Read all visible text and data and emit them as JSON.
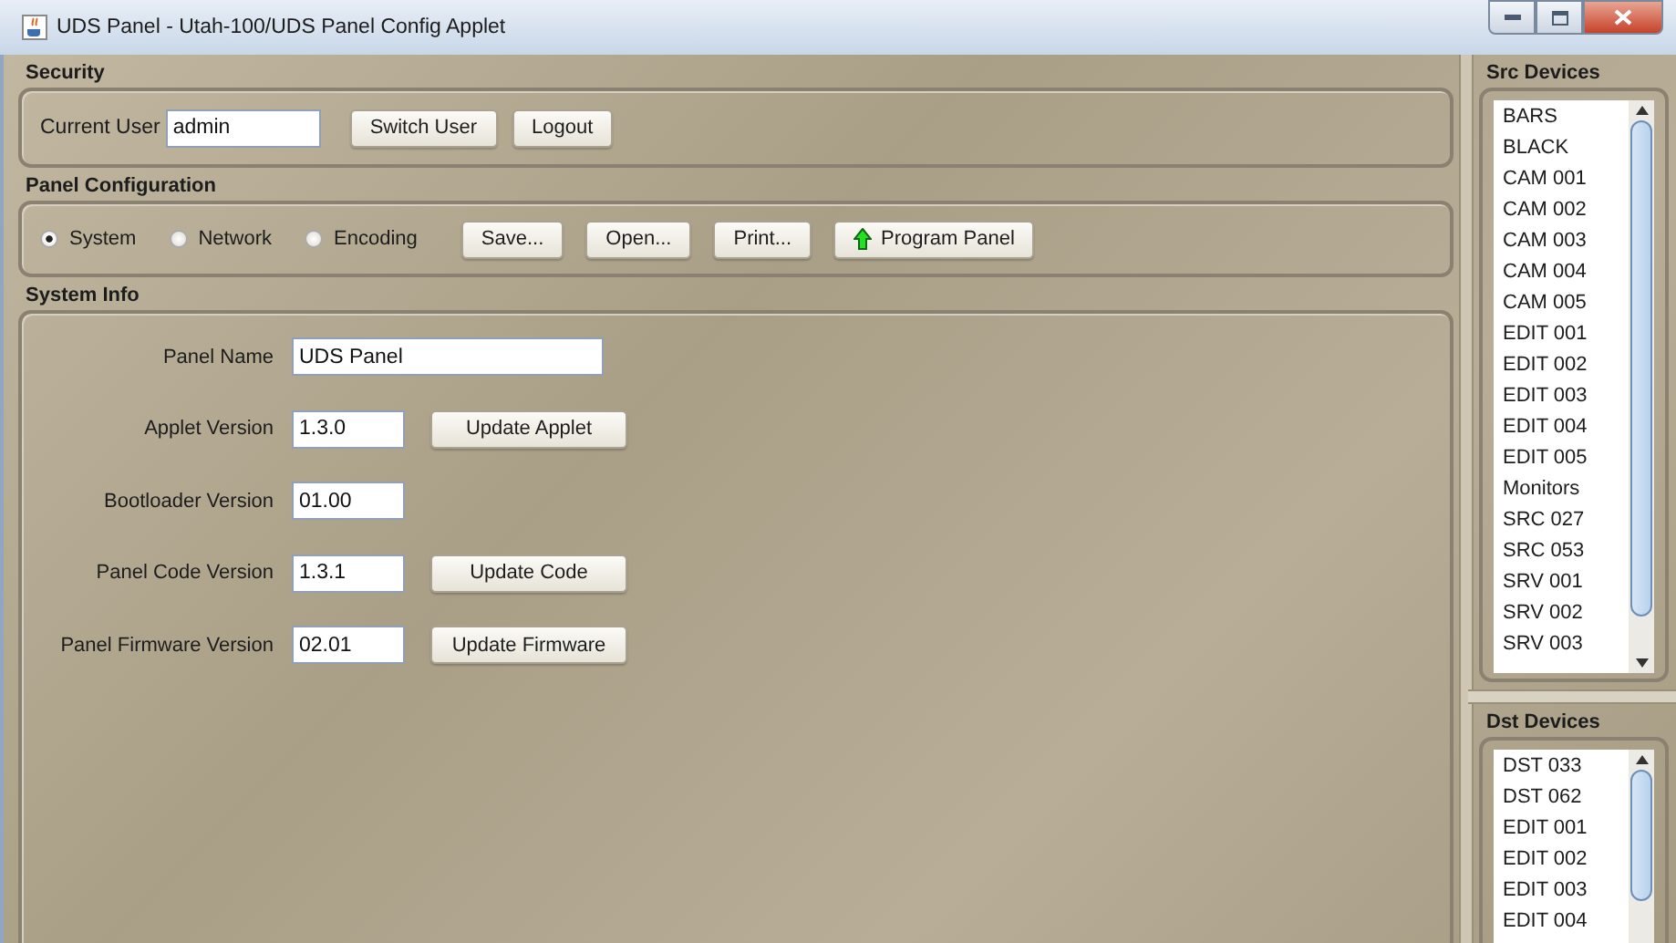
{
  "window": {
    "title": "UDS Panel - Utah-100/UDS Panel Config Applet"
  },
  "security": {
    "title": "Security",
    "user_label": "Current User",
    "user_value": "admin",
    "buttons": [
      "Switch User",
      "Logout"
    ]
  },
  "panel_configuration": {
    "title": "Panel Configuration",
    "modes": [
      {
        "label": "System",
        "selected": true
      },
      {
        "label": "Network",
        "selected": false
      },
      {
        "label": "Encoding",
        "selected": false
      }
    ],
    "buttons": [
      {
        "label": "Save...",
        "kind": "plain"
      },
      {
        "label": "Open...",
        "kind": "plain"
      },
      {
        "label": "Print...",
        "kind": "plain"
      },
      {
        "label": "Program Panel",
        "kind": "upload"
      }
    ]
  },
  "system_info": {
    "title": "System Info",
    "fields": [
      {
        "label": "Panel Name",
        "value": "UDS Panel",
        "kind": "wide"
      },
      {
        "label": "Applet Version",
        "value": "1.3.0",
        "kind": "short",
        "button": "Update Applet"
      },
      {
        "label": "Bootloader Version",
        "value": "01.00",
        "kind": "short"
      },
      {
        "label": "Panel Code Version",
        "value": "1.3.1",
        "kind": "short",
        "button": "Update Code"
      },
      {
        "label": "Panel Firmware Version",
        "value": "02.01",
        "kind": "short",
        "button": "Update Firmware"
      }
    ]
  },
  "src_devices": {
    "title": "Src Devices",
    "items": [
      "BARS",
      "BLACK",
      "CAM 001",
      "CAM 002",
      "CAM 003",
      "CAM 004",
      "CAM 005",
      "EDIT 001",
      "EDIT 002",
      "EDIT 003",
      "EDIT 004",
      "EDIT 005",
      "Monitors",
      "SRC 027",
      "SRC 053",
      "SRV 001",
      "SRV 002",
      "SRV 003"
    ]
  },
  "dst_devices": {
    "title": "Dst Devices",
    "items": [
      "DST 033",
      "DST 062",
      "EDIT 001",
      "EDIT 002",
      "EDIT 003",
      "EDIT 004"
    ]
  }
}
